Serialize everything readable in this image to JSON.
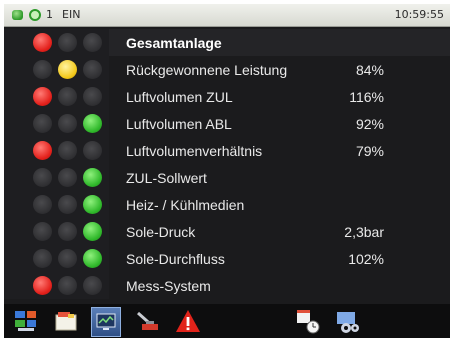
{
  "statusbar": {
    "indicator_number": "1",
    "mode": "EIN",
    "time": "10:59:55"
  },
  "rows": [
    {
      "label": "Gesamtanlage",
      "value": "",
      "led": "red",
      "header": true
    },
    {
      "label": "Rückgewonnene Leistung",
      "value": "84%",
      "led": "yellow"
    },
    {
      "label": "Luftvolumen ZUL",
      "value": "116%",
      "led": "red"
    },
    {
      "label": "Luftvolumen ABL",
      "value": "92%",
      "led": "green"
    },
    {
      "label": "Luftvolumenverhältnis",
      "value": "79%",
      "led": "red"
    },
    {
      "label": "ZUL-Sollwert",
      "value": "",
      "led": "green"
    },
    {
      "label": "Heiz- / Kühlmedien",
      "value": "",
      "led": "green"
    },
    {
      "label": "Sole-Druck",
      "value": "2,3bar",
      "led": "green"
    },
    {
      "label": "Sole-Durchfluss",
      "value": "102%",
      "led": "green"
    },
    {
      "label": "Mess-System",
      "value": "",
      "led": "red"
    }
  ],
  "toolbar": {
    "icons": [
      "overview-icon",
      "folder-icon",
      "monitor-icon",
      "service-icon",
      "alarm-icon",
      "calendar-clock-icon",
      "settings-icon"
    ],
    "active": "monitor-icon"
  },
  "colors": {
    "red": "#e3201b",
    "yellow": "#f3c81a",
    "green": "#2fb82a",
    "background": "#1b1b1d"
  }
}
